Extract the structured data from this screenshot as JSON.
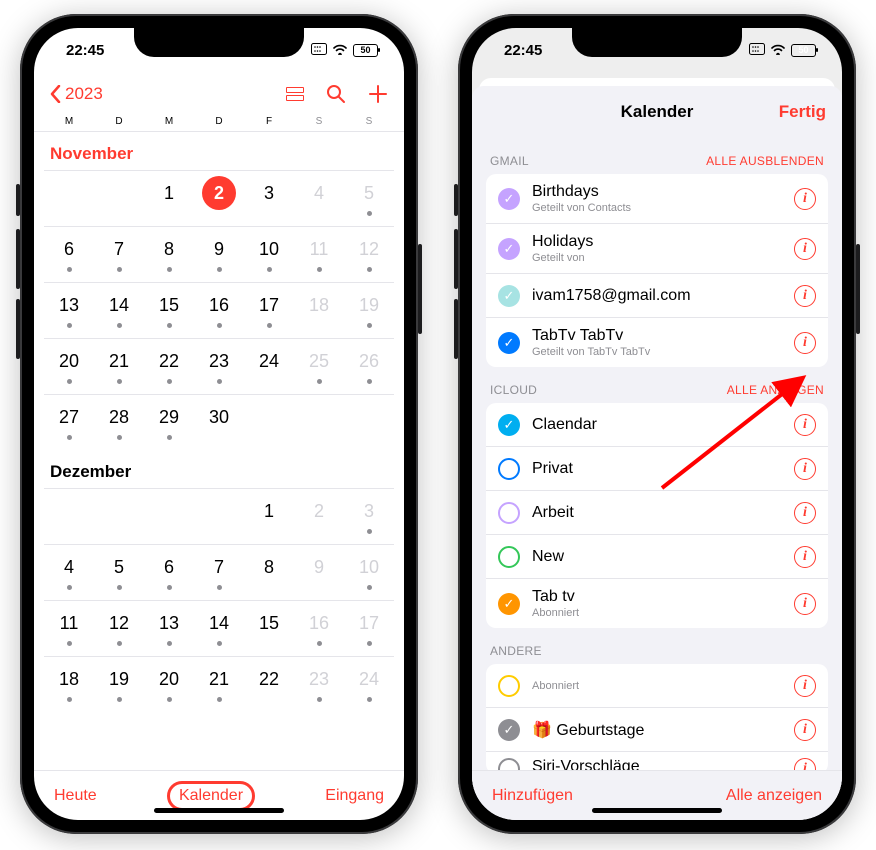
{
  "status": {
    "time": "22:45",
    "battery": "50"
  },
  "left": {
    "back_year": "2023",
    "weekdays": [
      "M",
      "D",
      "M",
      "D",
      "F",
      "S",
      "S"
    ],
    "toolbar": {
      "today": "Heute",
      "center": "Kalender",
      "inbox": "Eingang"
    },
    "months": [
      {
        "name": "November",
        "red": true,
        "offset": 2,
        "days": [
          {
            "n": 1,
            "dots": 0
          },
          {
            "n": 2,
            "dots": 0,
            "today": true
          },
          {
            "n": 3,
            "dots": 0
          },
          {
            "n": 4,
            "dots": 0,
            "dim": true
          },
          {
            "n": 5,
            "dots": 1,
            "dim": true
          },
          {
            "n": 6,
            "dots": 1
          },
          {
            "n": 7,
            "dots": 1
          },
          {
            "n": 8,
            "dots": 1
          },
          {
            "n": 9,
            "dots": 1
          },
          {
            "n": 10,
            "dots": 1
          },
          {
            "n": 11,
            "dots": 1,
            "dim": true
          },
          {
            "n": 12,
            "dots": 1,
            "dim": true
          },
          {
            "n": 13,
            "dots": 1
          },
          {
            "n": 14,
            "dots": 1
          },
          {
            "n": 15,
            "dots": 1
          },
          {
            "n": 16,
            "dots": 1
          },
          {
            "n": 17,
            "dots": 1
          },
          {
            "n": 18,
            "dots": 0,
            "dim": true
          },
          {
            "n": 19,
            "dots": 1,
            "dim": true
          },
          {
            "n": 20,
            "dots": 1
          },
          {
            "n": 21,
            "dots": 1
          },
          {
            "n": 22,
            "dots": 1
          },
          {
            "n": 23,
            "dots": 1
          },
          {
            "n": 24,
            "dots": 0
          },
          {
            "n": 25,
            "dots": 1,
            "dim": true
          },
          {
            "n": 26,
            "dots": 1,
            "dim": true
          },
          {
            "n": 27,
            "dots": 1
          },
          {
            "n": 28,
            "dots": 1
          },
          {
            "n": 29,
            "dots": 1
          },
          {
            "n": 30,
            "dots": 0
          }
        ]
      },
      {
        "name": "Dezember",
        "red": false,
        "offset": 4,
        "days": [
          {
            "n": 1,
            "dots": 0
          },
          {
            "n": 2,
            "dots": 0,
            "dim": true
          },
          {
            "n": 3,
            "dots": 1,
            "dim": true
          },
          {
            "n": 4,
            "dots": 1
          },
          {
            "n": 5,
            "dots": 1
          },
          {
            "n": 6,
            "dots": 1
          },
          {
            "n": 7,
            "dots": 1
          },
          {
            "n": 8,
            "dots": 0
          },
          {
            "n": 9,
            "dots": 0,
            "dim": true
          },
          {
            "n": 10,
            "dots": 1,
            "dim": true
          },
          {
            "n": 11,
            "dots": 1
          },
          {
            "n": 12,
            "dots": 1
          },
          {
            "n": 13,
            "dots": 1
          },
          {
            "n": 14,
            "dots": 1
          },
          {
            "n": 15,
            "dots": 0
          },
          {
            "n": 16,
            "dots": 1,
            "dim": true
          },
          {
            "n": 17,
            "dots": 1,
            "dim": true
          },
          {
            "n": 18,
            "dots": 1
          },
          {
            "n": 19,
            "dots": 1
          },
          {
            "n": 20,
            "dots": 1
          },
          {
            "n": 21,
            "dots": 1
          },
          {
            "n": 22,
            "dots": 0
          },
          {
            "n": 23,
            "dots": 1,
            "dim": true
          },
          {
            "n": 24,
            "dots": 1,
            "dim": true
          }
        ]
      }
    ]
  },
  "right": {
    "title": "Kalender",
    "done": "Fertig",
    "footer": {
      "add": "Hinzufügen",
      "show_all": "Alle anzeigen"
    },
    "sections": [
      {
        "name": "GMAIL",
        "action": "ALLE AUSBLENDEN",
        "items": [
          {
            "name": "Birthdays",
            "sub": "Geteilt von Contacts",
            "color": "#c5a3ff",
            "checked": true
          },
          {
            "name": "Holidays",
            "sub": "Geteilt von",
            "color": "#c5a3ff",
            "checked": true
          },
          {
            "name": "ivam1758@gmail.com",
            "sub": "",
            "color": "#a7e3e3",
            "checked": true
          },
          {
            "name": "TabTv TabTv",
            "sub": "Geteilt von TabTv TabTv",
            "color": "#007aff",
            "checked": true
          }
        ]
      },
      {
        "name": "ICLOUD",
        "action": "ALLE ANZEIGEN",
        "items": [
          {
            "name": "Claendar",
            "sub": "",
            "color": "#00aef0",
            "checked": true
          },
          {
            "name": "Privat",
            "sub": "",
            "color": "#007aff",
            "checked": false
          },
          {
            "name": "Arbeit",
            "sub": "",
            "color": "#c5a3ff",
            "checked": false
          },
          {
            "name": "New",
            "sub": "",
            "color": "#34c759",
            "checked": false
          },
          {
            "name": "Tab tv",
            "sub": "Abonniert",
            "color": "#ff9500",
            "checked": true
          }
        ]
      },
      {
        "name": "ANDERE",
        "action": "",
        "items": [
          {
            "name": "",
            "sub": "Abonniert",
            "color": "#ffcc00",
            "checked": false,
            "nameless": true
          },
          {
            "name": "Geburtstage",
            "sub": "",
            "color": "#8e8e93",
            "checked": true,
            "gift": true
          },
          {
            "name": "Siri-Vorschläge",
            "sub": "",
            "color": "#8e8e93",
            "checked": false,
            "cut": true
          }
        ]
      }
    ]
  }
}
